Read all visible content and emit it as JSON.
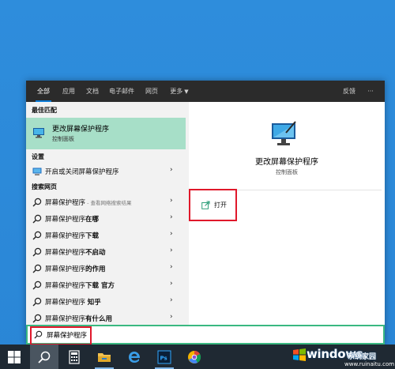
{
  "tabs": [
    {
      "label": "全部",
      "active": true
    },
    {
      "label": "应用",
      "active": false
    },
    {
      "label": "文档",
      "active": false
    },
    {
      "label": "电子邮件",
      "active": false
    },
    {
      "label": "网页",
      "active": false
    },
    {
      "label": "更多",
      "active": false
    },
    {
      "label": "反馈",
      "active": false
    },
    {
      "label": "···",
      "active": false
    }
  ],
  "sections": {
    "best_match": "最佳匹配",
    "settings": "设置",
    "web": "搜索网页"
  },
  "best_match": {
    "title": "更改屏幕保护程序",
    "subtitle": "控制面板"
  },
  "settings_item": "开启或关闭屏幕保护程序",
  "web_items": [
    {
      "normal": "屏幕保护程序",
      "bold": "",
      "sub": " - 查看网络搜索结果"
    },
    {
      "normal": "屏幕保护程序",
      "bold": "在哪",
      "sub": ""
    },
    {
      "normal": "屏幕保护程序",
      "bold": "下载",
      "sub": ""
    },
    {
      "normal": "屏幕保护程序",
      "bold": "不启动",
      "sub": ""
    },
    {
      "normal": "屏幕保护程序",
      "bold": "的作用",
      "sub": ""
    },
    {
      "normal": "屏幕保护程序",
      "bold": "下载 官方",
      "sub": ""
    },
    {
      "normal": "屏幕保护程序 ",
      "bold": "知乎",
      "sub": ""
    },
    {
      "normal": "屏幕保护程序",
      "bold": "有什么用",
      "sub": ""
    }
  ],
  "detail": {
    "title": "更改屏幕保护程序",
    "subtitle": "控制面板",
    "open_label": "打开"
  },
  "search": {
    "value": "屏幕保护程序"
  },
  "watermark": {
    "brand": "windows",
    "suffix": "系统家园",
    "url": "www.ruinaitu.com"
  },
  "colors": {
    "accent": "#0a7ad6",
    "selection": "#a7dfc8",
    "highlight_box": "#e0182b",
    "search_border": "#3ab881"
  }
}
